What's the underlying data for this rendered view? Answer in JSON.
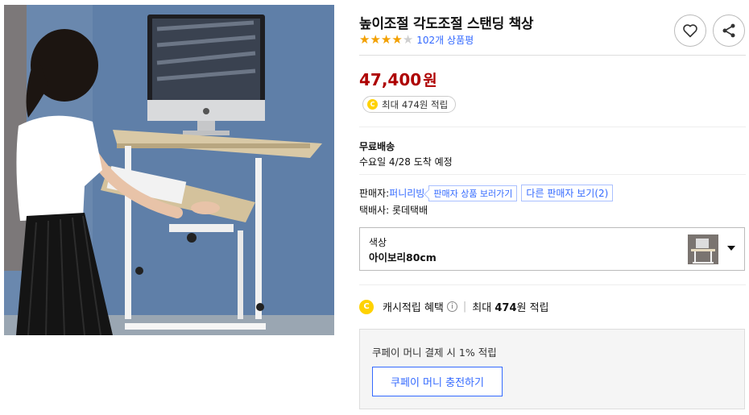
{
  "product": {
    "image_alt": "스탠딩 책상 사용 모습",
    "title": "높이조절 각도조절 스탠딩 책상",
    "rating": {
      "stars": 4,
      "max": 5,
      "review_text": "102개 상품평"
    },
    "price": {
      "amount": "47,400",
      "unit": "원"
    },
    "reward": {
      "coin": "C",
      "text": "최대 474원 적립"
    }
  },
  "icons": {
    "wishlist": "heart-icon",
    "share": "share-icon"
  },
  "shipping": {
    "title": "무료배송",
    "date": "수요일 4/28 도착 예정"
  },
  "seller": {
    "label": "판매자:",
    "name": "퍼니리빙",
    "view_products": "판매자 상품 보러가기",
    "other_sellers": "다른 판매자 보기(2)",
    "courier": "택배사: 롯데택배"
  },
  "option": {
    "label": "색상",
    "value": "아이보리80cm"
  },
  "cash": {
    "coin": "C",
    "title": "캐시적립 혜택",
    "info": "i",
    "separator": "|",
    "max_prefix": "최대",
    "max_amount": "474",
    "max_suffix": "원 적립"
  },
  "coupay": {
    "text": "쿠페이 머니 결제 시 1% 적립",
    "button": "쿠페이 머니 충전하기"
  },
  "colors": {
    "price": "#ae0000",
    "link": "#346aff",
    "star": "#f2a000",
    "coin": "#ffd200"
  }
}
